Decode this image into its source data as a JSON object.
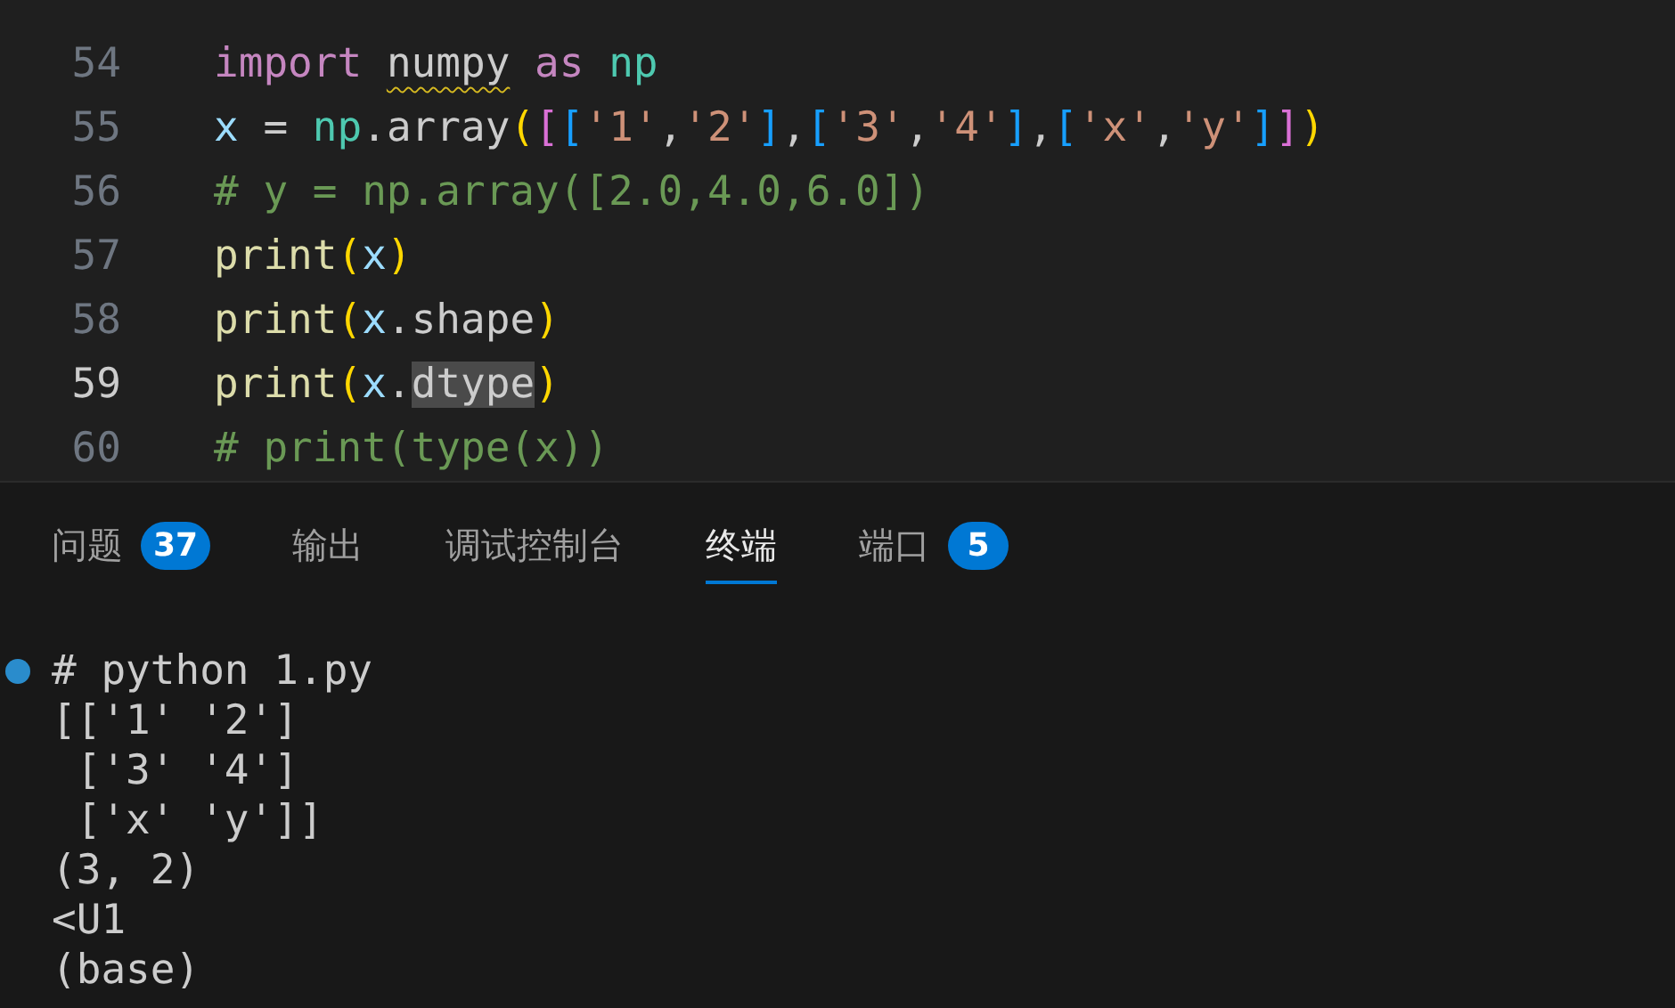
{
  "editor": {
    "lines": [
      {
        "number": "54",
        "active": false,
        "tokens": [
          {
            "text": "import ",
            "kind": "keyword"
          },
          {
            "text": "numpy",
            "kind": "warning"
          },
          {
            "text": " as ",
            "kind": "keyword"
          },
          {
            "text": "np",
            "kind": "module"
          }
        ]
      },
      {
        "number": "55",
        "active": false,
        "tokens": [
          {
            "text": "x",
            "kind": "variable"
          },
          {
            "text": " = ",
            "kind": "plain"
          },
          {
            "text": "np",
            "kind": "module"
          },
          {
            "text": ".array",
            "kind": "plain"
          },
          {
            "text": "(",
            "kind": "paren"
          },
          {
            "text": "[",
            "kind": "bracket_outer"
          },
          {
            "text": "[",
            "kind": "bracket_inner"
          },
          {
            "text": "'1'",
            "kind": "string"
          },
          {
            "text": ",",
            "kind": "plain"
          },
          {
            "text": "'2'",
            "kind": "string"
          },
          {
            "text": "]",
            "kind": "bracket_inner"
          },
          {
            "text": ",",
            "kind": "plain"
          },
          {
            "text": "[",
            "kind": "bracket_inner"
          },
          {
            "text": "'3'",
            "kind": "string"
          },
          {
            "text": ",",
            "kind": "plain"
          },
          {
            "text": "'4'",
            "kind": "string"
          },
          {
            "text": "]",
            "kind": "bracket_inner"
          },
          {
            "text": ",",
            "kind": "plain"
          },
          {
            "text": "[",
            "kind": "bracket_inner"
          },
          {
            "text": "'x'",
            "kind": "string"
          },
          {
            "text": ",",
            "kind": "plain"
          },
          {
            "text": "'y'",
            "kind": "string"
          },
          {
            "text": "]",
            "kind": "bracket_inner"
          },
          {
            "text": "]",
            "kind": "bracket_outer"
          },
          {
            "text": ")",
            "kind": "paren"
          }
        ]
      },
      {
        "number": "56",
        "active": false,
        "tokens": [
          {
            "text": "# y = np.array([2.0,4.0,6.0])",
            "kind": "comment"
          }
        ]
      },
      {
        "number": "57",
        "active": false,
        "tokens": [
          {
            "text": "print",
            "kind": "function"
          },
          {
            "text": "(",
            "kind": "paren"
          },
          {
            "text": "x",
            "kind": "variable"
          },
          {
            "text": ")",
            "kind": "paren"
          }
        ]
      },
      {
        "number": "58",
        "active": false,
        "tokens": [
          {
            "text": "print",
            "kind": "function"
          },
          {
            "text": "(",
            "kind": "paren"
          },
          {
            "text": "x",
            "kind": "variable"
          },
          {
            "text": ".shape",
            "kind": "plain"
          },
          {
            "text": ")",
            "kind": "paren"
          }
        ]
      },
      {
        "number": "59",
        "active": true,
        "tokens": [
          {
            "text": "print",
            "kind": "function"
          },
          {
            "text": "(",
            "kind": "paren"
          },
          {
            "text": "x",
            "kind": "variable"
          },
          {
            "text": ".",
            "kind": "plain"
          },
          {
            "text": "dtype",
            "kind": "highlight"
          },
          {
            "text": ")",
            "kind": "paren"
          }
        ]
      },
      {
        "number": "60",
        "active": false,
        "tokens": [
          {
            "text": "# print(type(x))",
            "kind": "comment"
          }
        ]
      }
    ]
  },
  "panel": {
    "tabs": [
      {
        "label": "问题",
        "badge": "37",
        "selected": false
      },
      {
        "label": "输出",
        "selected": false
      },
      {
        "label": "调试控制台",
        "selected": false
      },
      {
        "label": "终端",
        "selected": true
      },
      {
        "label": "端口",
        "badge": "5",
        "selected": false
      }
    ]
  },
  "terminal": {
    "lines": [
      {
        "kind": "command",
        "text": "# python 1.py"
      },
      {
        "kind": "output",
        "text": "[['1' '2']"
      },
      {
        "kind": "output",
        "text": " ['3' '4']"
      },
      {
        "kind": "output",
        "text": " ['x' 'y']]"
      },
      {
        "kind": "output",
        "text": "(3, 2)"
      },
      {
        "kind": "output",
        "text": "<U1"
      },
      {
        "kind": "output",
        "text": "(base)"
      }
    ]
  }
}
